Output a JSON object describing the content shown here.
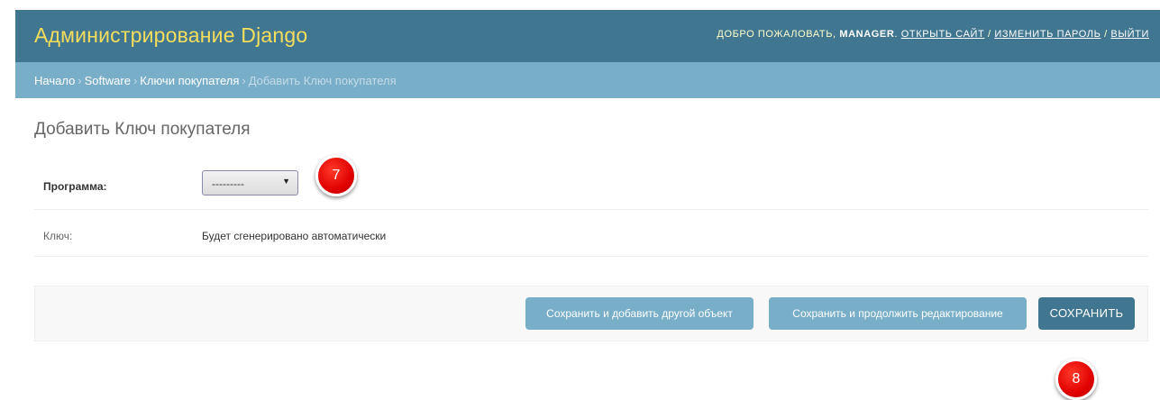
{
  "header": {
    "branding": "Администрирование Django",
    "welcome": "Добро пожаловать,",
    "username": "MANAGER",
    "view_site": "Открыть сайт",
    "change_password": "Изменить пароль",
    "logout": "Выйти",
    "separator": "/"
  },
  "breadcrumbs": {
    "home": "Начало",
    "app": "Software",
    "model": "Ключи покупателя",
    "current": "Добавить Ключ покупателя",
    "separator": "›"
  },
  "page_title": "Добавить Ключ покупателя",
  "form": {
    "program_label": "Программа:",
    "program_value": "---------",
    "key_label": "Ключ:",
    "key_value": "Будет сгенерировано автоматически"
  },
  "submit_row": {
    "save_add_another": "Сохранить и добавить другой объект",
    "save_continue": "Сохранить и продолжить редактирование",
    "save": "СОХРАНИТЬ"
  },
  "annotations": {
    "step_7": "7",
    "step_8": "8"
  },
  "colors": {
    "header_bg": "#417690",
    "branding": "#f5dd5d",
    "breadcrumbs_bg": "#79aec8",
    "button_secondary": "#79aec8",
    "button_primary": "#417690",
    "badge": "#e00000"
  }
}
